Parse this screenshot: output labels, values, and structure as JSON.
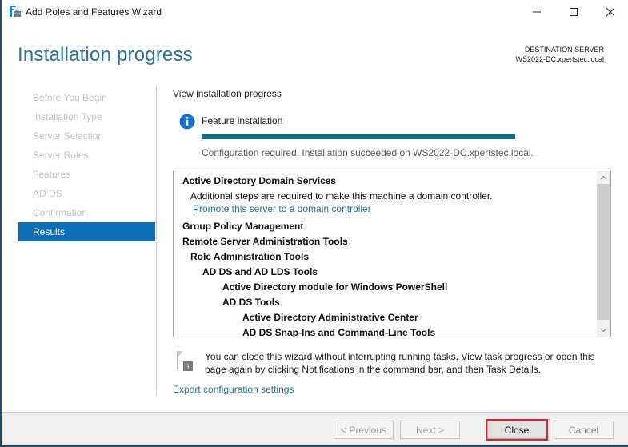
{
  "window": {
    "title": "Add Roles and Features Wizard",
    "controls": {
      "minimize": "minimize-icon",
      "maximize": "maximize-icon",
      "close": "close-icon"
    }
  },
  "header": {
    "page_title": "Installation progress",
    "destination_label": "DESTINATION SERVER",
    "destination_server": "WS2022-DC.xpertstec.local"
  },
  "sidebar": {
    "items": [
      {
        "label": "Before You Begin",
        "active": false
      },
      {
        "label": "Installation Type",
        "active": false
      },
      {
        "label": "Server Selection",
        "active": false
      },
      {
        "label": "Server Roles",
        "active": false
      },
      {
        "label": "Features",
        "active": false
      },
      {
        "label": "AD DS",
        "active": false
      },
      {
        "label": "Confirmation",
        "active": false
      },
      {
        "label": "Results",
        "active": true
      }
    ]
  },
  "main": {
    "section_title": "View installation progress",
    "feature_label": "Feature installation",
    "progress_percent": 100,
    "status_text": "Configuration required. Installation succeeded on WS2022-DC.xpertstec.local.",
    "results": [
      {
        "text": "Active Directory Domain Services",
        "level": 0,
        "bold": true,
        "type": "heading"
      },
      {
        "text": "Additional steps are required to make this machine a domain controller.",
        "level": 1,
        "bold": false,
        "type": "text"
      },
      {
        "text": "Promote this server to a domain controller",
        "level": 1,
        "bold": false,
        "type": "link"
      },
      {
        "text": "Group Policy Management",
        "level": 0,
        "bold": true,
        "type": "heading"
      },
      {
        "text": "Remote Server Administration Tools",
        "level": 0,
        "bold": true,
        "type": "heading"
      },
      {
        "text": "Role Administration Tools",
        "level": 1,
        "bold": true,
        "type": "heading"
      },
      {
        "text": "AD DS and AD LDS Tools",
        "level": 2,
        "bold": true,
        "type": "heading"
      },
      {
        "text": "Active Directory module for Windows PowerShell",
        "level": 3,
        "bold": true,
        "type": "heading"
      },
      {
        "text": "AD DS Tools",
        "level": 3,
        "bold": true,
        "type": "heading"
      },
      {
        "text": "Active Directory Administrative Center",
        "level": 4,
        "bold": true,
        "type": "heading"
      },
      {
        "text": "AD DS Snap-Ins and Command-Line Tools",
        "level": 4,
        "bold": true,
        "type": "heading"
      }
    ],
    "note_badge": "1",
    "note_text": "You can close this wizard without interrupting running tasks. View task progress or open this page again by clicking Notifications in the command bar, and then Task Details.",
    "export_link": "Export configuration settings"
  },
  "footer": {
    "previous_label": "< Previous",
    "next_label": "Next >",
    "close_label": "Close",
    "cancel_label": "Cancel"
  },
  "colors": {
    "accent": "#2b7494",
    "active_nav": "#0f6fb6",
    "progress": "#0f6f8a",
    "highlight_border": "#d9262e"
  }
}
